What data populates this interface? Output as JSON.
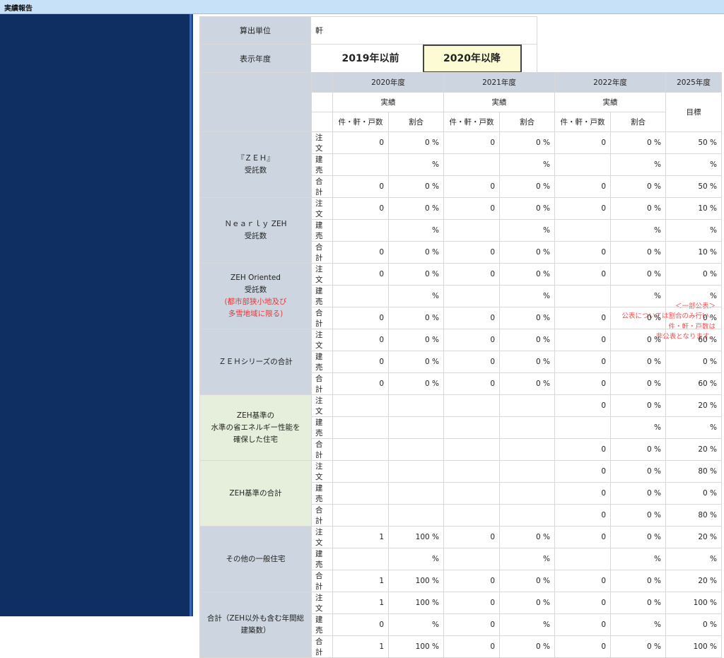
{
  "header": {
    "title": "実績報告"
  },
  "sidebar": {
    "label": "実績報告",
    "note": [
      "＜一部公表＞",
      "公表については割合のみ行い、",
      "件・軒・戸数は",
      "非公表となります。"
    ]
  },
  "info": {
    "unit_label": "算出単位",
    "unit_value": "軒",
    "year_label": "表示年度",
    "btn_before": "2019年以前",
    "btn_after": "2020年以降"
  },
  "table": {
    "years": [
      "2020年度",
      "2021年度",
      "2022年度",
      "2025年度"
    ],
    "actual": "実績",
    "target": "目標",
    "count_col": "件・軒・戸数",
    "ratio_col": "割合",
    "row_labels": [
      "注文",
      "建売",
      "合計"
    ],
    "groups": [
      {
        "label": [
          "『ＺＥＨ』",
          "受託数"
        ],
        "rows": [
          [
            "0",
            "0 %",
            "0",
            "0 %",
            "0",
            "0 %",
            "50 %"
          ],
          [
            "",
            "%",
            "",
            "%",
            "",
            "%",
            "%"
          ],
          [
            "0",
            "0 %",
            "0",
            "0 %",
            "0",
            "0 %",
            "50 %"
          ]
        ]
      },
      {
        "label": [
          "Ｎｅａｒｌｙ ZEH",
          "受託数"
        ],
        "rows": [
          [
            "0",
            "0 %",
            "0",
            "0 %",
            "0",
            "0 %",
            "10 %"
          ],
          [
            "",
            "%",
            "",
            "%",
            "",
            "%",
            "%"
          ],
          [
            "0",
            "0 %",
            "0",
            "0 %",
            "0",
            "0 %",
            "10 %"
          ]
        ]
      },
      {
        "label": [
          "ZEH Oriented",
          "受託数"
        ],
        "label_note": [
          "(都市部狭小地及び",
          "多雪地域に限る)"
        ],
        "rows": [
          [
            "0",
            "0 %",
            "0",
            "0 %",
            "0",
            "0 %",
            "0 %"
          ],
          [
            "",
            "%",
            "",
            "%",
            "",
            "%",
            "%"
          ],
          [
            "0",
            "0 %",
            "0",
            "0 %",
            "0",
            "0 %",
            "0 %"
          ]
        ]
      },
      {
        "label": [
          "ＺＥＨシリーズの合計"
        ],
        "rows": [
          [
            "0",
            "0 %",
            "0",
            "0 %",
            "0",
            "0 %",
            "60 %"
          ],
          [
            "0",
            "0 %",
            "0",
            "0 %",
            "0",
            "0 %",
            "0 %"
          ],
          [
            "0",
            "0 %",
            "0",
            "0 %",
            "0",
            "0 %",
            "60 %"
          ]
        ]
      },
      {
        "label": [
          "ZEH基準の",
          "水準の省エネルギー性能を",
          "確保した住宅"
        ],
        "green": true,
        "rows": [
          [
            "",
            "",
            "",
            "",
            "0",
            "0 %",
            "20 %"
          ],
          [
            "",
            "",
            "",
            "",
            "",
            "%",
            "%"
          ],
          [
            "",
            "",
            "",
            "",
            "0",
            "0 %",
            "20 %"
          ]
        ]
      },
      {
        "label": [
          "ZEH基準の合計"
        ],
        "green": true,
        "rows": [
          [
            "",
            "",
            "",
            "",
            "0",
            "0 %",
            "80 %"
          ],
          [
            "",
            "",
            "",
            "",
            "0",
            "0 %",
            "0 %"
          ],
          [
            "",
            "",
            "",
            "",
            "0",
            "0 %",
            "80 %"
          ]
        ]
      },
      {
        "label": [
          "その他の一般住宅"
        ],
        "rows": [
          [
            "1",
            "100 %",
            "0",
            "0 %",
            "0",
            "0 %",
            "20 %"
          ],
          [
            "",
            "%",
            "",
            "%",
            "",
            "%",
            "%"
          ],
          [
            "1",
            "100 %",
            "0",
            "0 %",
            "0",
            "0 %",
            "20 %"
          ]
        ]
      },
      {
        "label": [
          "合計（ZEH以外も含む年間総",
          "建築数）"
        ],
        "rows": [
          [
            "1",
            "100 %",
            "0",
            "0 %",
            "0",
            "0 %",
            "100 %"
          ],
          [
            "0",
            "%",
            "0",
            "%",
            "0",
            "%",
            "0 %"
          ],
          [
            "1",
            "100 %",
            "0",
            "0 %",
            "0",
            "0 %",
            "100 %"
          ]
        ]
      }
    ]
  }
}
